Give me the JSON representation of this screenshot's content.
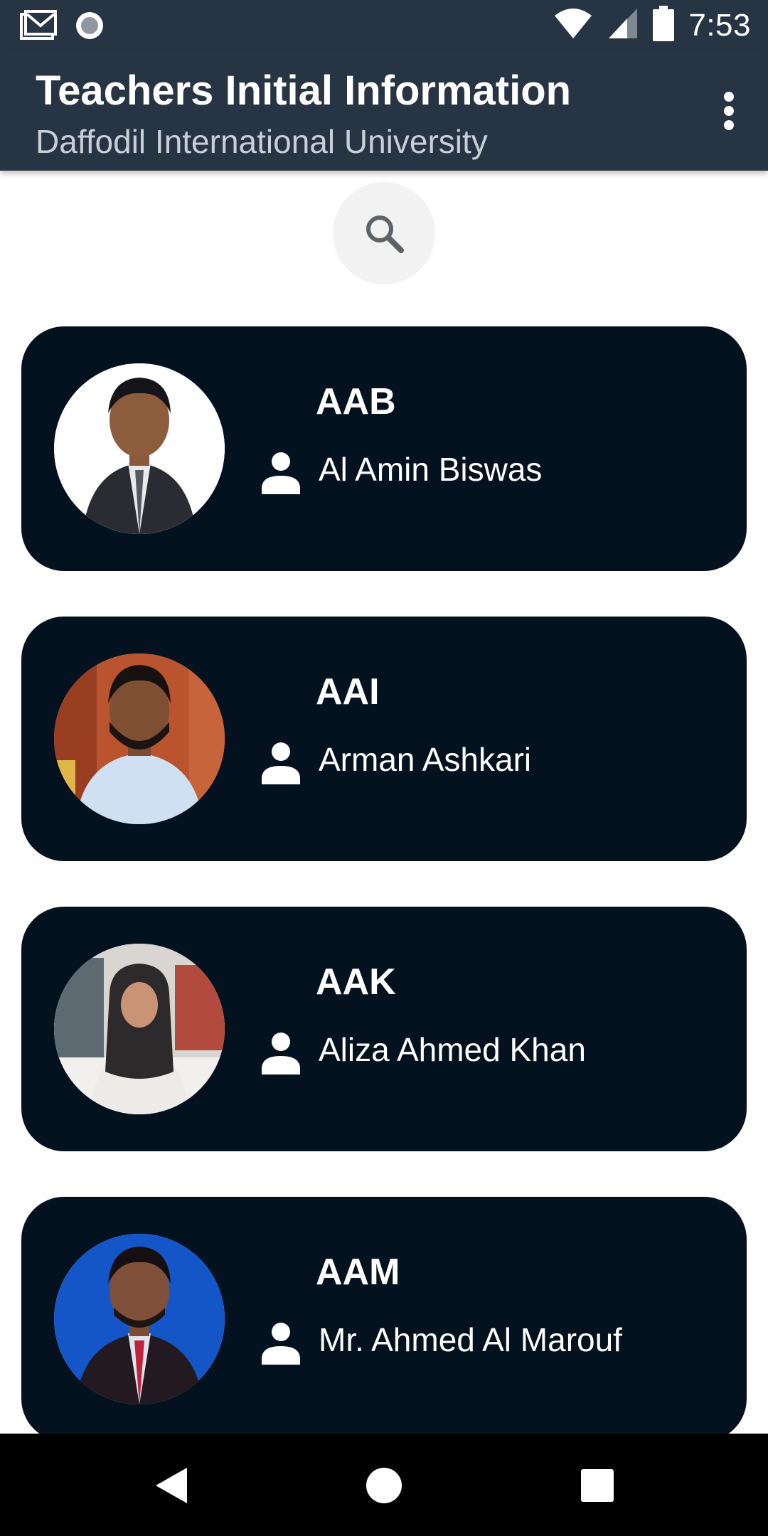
{
  "status_bar": {
    "time": "7:53",
    "left_icons": [
      "gmail-icon",
      "circle-notification-icon"
    ],
    "right_icons": [
      "wifi-icon",
      "signal-icon",
      "battery-icon"
    ]
  },
  "app_bar": {
    "title": "Teachers Initial Information",
    "subtitle": "Daffodil International University",
    "menu_icon": "more-vert-icon"
  },
  "search": {
    "icon": "search-icon"
  },
  "teachers": [
    {
      "initial": "AAB",
      "name": "Al Amin Biswas",
      "avatar": "teacher-photo"
    },
    {
      "initial": "AAI",
      "name": "Arman Ashkari",
      "avatar": "teacher-photo"
    },
    {
      "initial": "AAK",
      "name": "Aliza Ahmed Khan",
      "avatar": "teacher-photo"
    },
    {
      "initial": "AAM",
      "name": "Mr. Ahmed Al Marouf",
      "avatar": "teacher-photo"
    }
  ],
  "nav_bar": {
    "buttons": [
      "back-icon",
      "home-icon",
      "recents-icon"
    ]
  },
  "colors": {
    "app_bar": "#263443",
    "card": "#041220",
    "nav_bar": "#000000"
  }
}
